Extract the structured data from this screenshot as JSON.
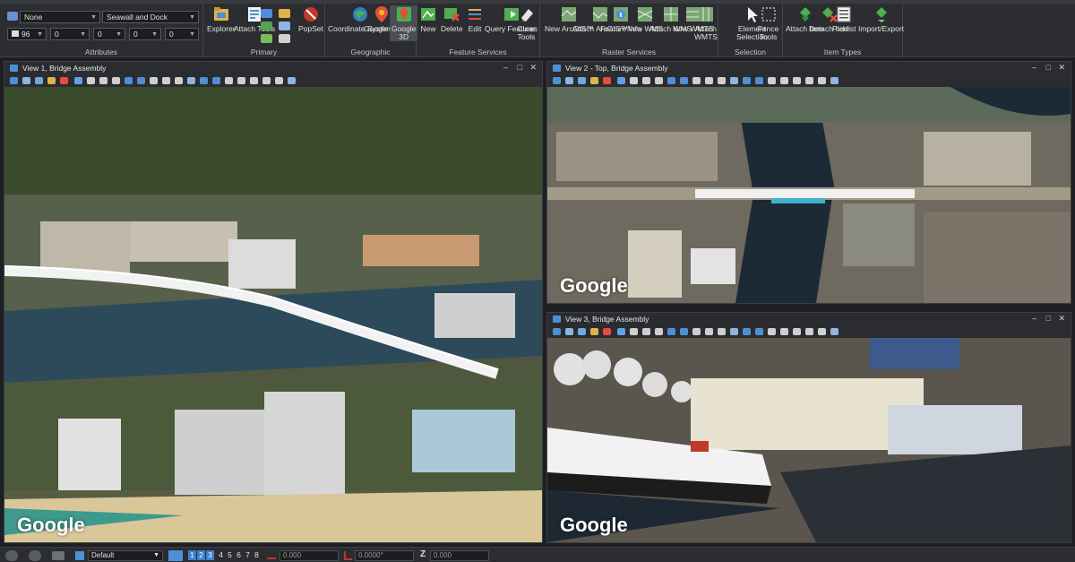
{
  "ribbon": {
    "attributes": {
      "level": "None",
      "template": "Seawall and Dock",
      "color": "96",
      "line_style": "0",
      "weight": "0",
      "transparency": "0",
      "priority": "0",
      "group_label": "Attributes"
    },
    "primary": {
      "explorer": "Explorer",
      "attach_tools": "Attach Tools",
      "popset": "PopSet",
      "group_label": "Primary"
    },
    "geographic": {
      "coordinate_system": "Coordinate System",
      "google_2d": "Google 2D",
      "google_3d": "Google 3D",
      "group_label": "Geographic"
    },
    "feature_services": {
      "new": "New",
      "delete": "Delete",
      "edit": "Edit",
      "query_features": "Query Features",
      "clear_tools": "Clear Tools",
      "group_label": "Feature Services"
    },
    "raster_services": {
      "new_arcgis": "New ArcGIS™",
      "attach_arcgis": "Attach ArcGIS™",
      "feature_info": "Feature Info",
      "new_wms": "New WMS",
      "attach_wms": "Attach WMS",
      "new_wmts": "New WMTS",
      "attach_wmts": "Attach WMTS",
      "group_label": "Raster Services"
    },
    "selection": {
      "element_selection": "Element Selection",
      "fence_tools": "Fence Tools",
      "group_label": "Selection"
    },
    "item_types": {
      "attach_item": "Attach Item",
      "detach_item": "Detach Item",
      "picklist": "Picklist",
      "import_export": "Import/Export",
      "group_label": "Item Types"
    }
  },
  "views": {
    "view1": {
      "title": "View 1, Bridge Assembly",
      "watermark": "Google"
    },
    "view2": {
      "title": "View 2 - Top, Bridge Assembly",
      "watermark": "Google"
    },
    "view3": {
      "title": "View 3, Bridge Assembly",
      "watermark": "Google"
    }
  },
  "window_controls": {
    "minimize": "–",
    "maximize": "□",
    "close": "✕"
  },
  "status": {
    "view_group": "Default",
    "view_numbers": [
      "1",
      "2",
      "3",
      "4",
      "5",
      "6",
      "7",
      "8"
    ],
    "active_views": [
      "1",
      "2",
      "3"
    ],
    "distance": "0.000",
    "angle": "0.0000°",
    "z": "0.000",
    "z_label": "Z"
  },
  "colors": {
    "accent": "#3f7fd0",
    "background": "#1e1f22",
    "panel": "#2b2d30"
  },
  "icons": [
    "explorer-icon",
    "attach-tools-icon",
    "popset-icon",
    "globe-icon",
    "map-pin-icon",
    "feature-new-icon",
    "feature-delete-icon",
    "feature-edit-icon",
    "query-icon",
    "clear-icon",
    "arcgis-icon",
    "wms-icon",
    "wmts-icon",
    "cursor-icon",
    "fence-icon",
    "attach-item-icon",
    "detach-item-icon",
    "picklist-icon",
    "import-export-icon"
  ]
}
